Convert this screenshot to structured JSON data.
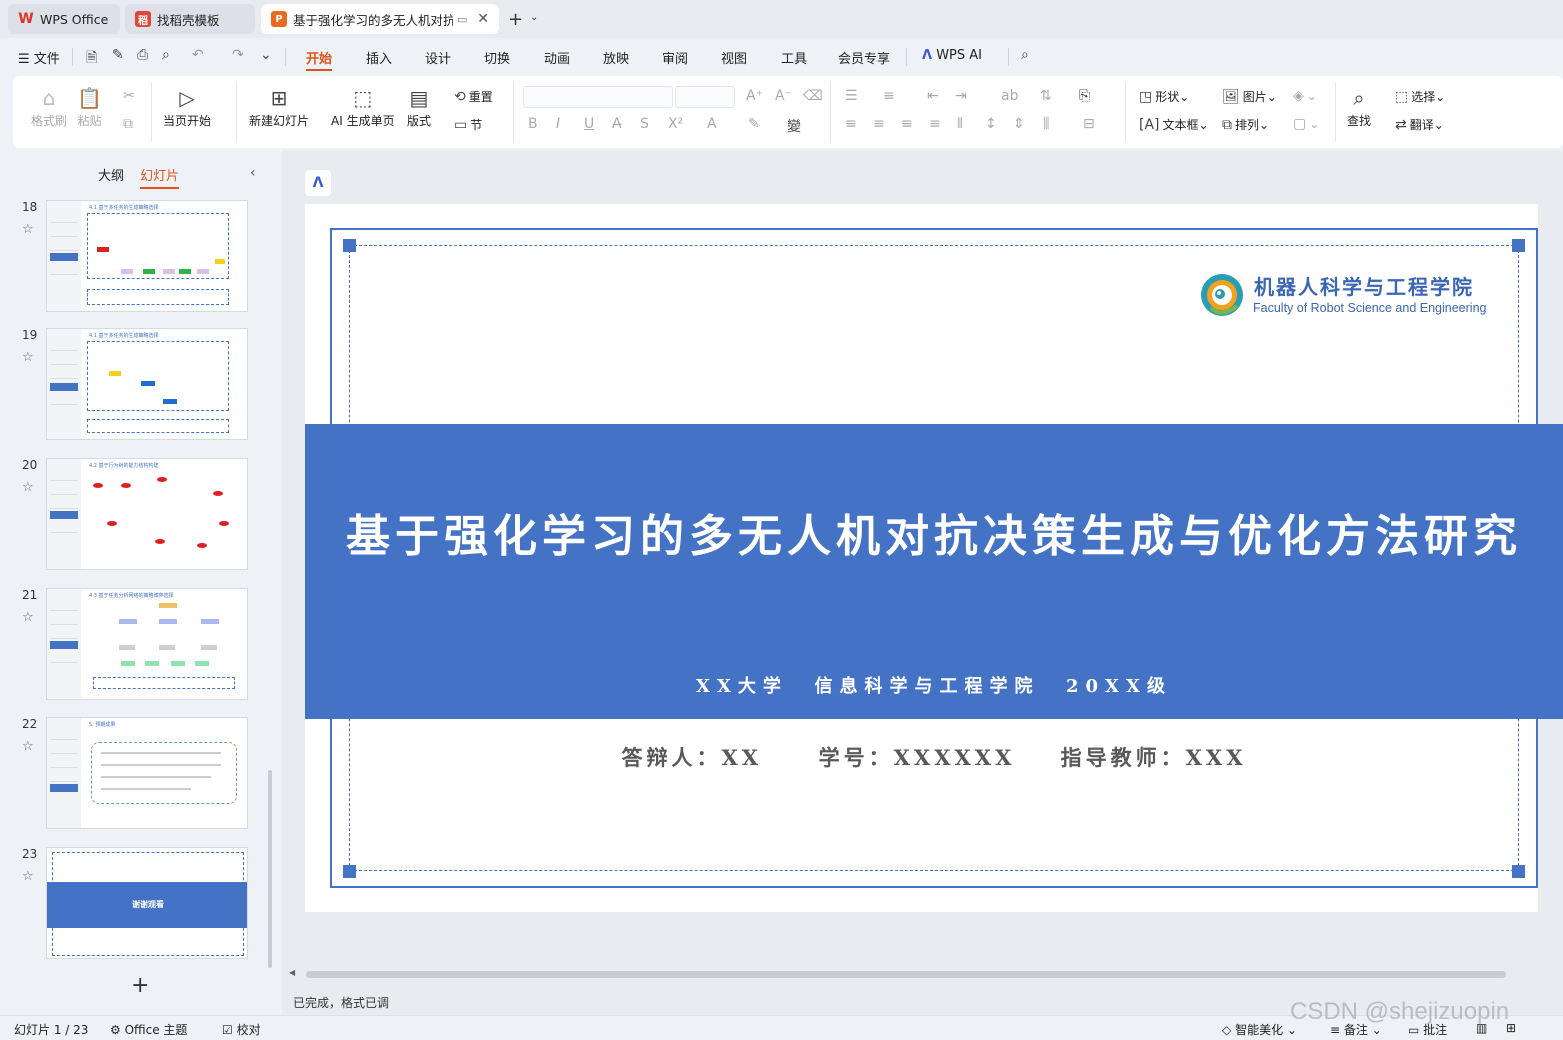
{
  "tabs": [
    {
      "label": "WPS Office"
    },
    {
      "label": "找稻壳模板"
    },
    {
      "label": "基于强化学习的多无人机对抗"
    }
  ],
  "menu": {
    "file": "文件",
    "items": [
      "开始",
      "插入",
      "设计",
      "切换",
      "动画",
      "放映",
      "审阅",
      "视图",
      "工具",
      "会员专享",
      "WPS AI"
    ],
    "active": "开始"
  },
  "ribbon": {
    "format_painter": "格式刷",
    "paste": "粘贴",
    "from_current": "当页开始",
    "new_slide": "新建幻灯片",
    "ai_single": "AI 生成单页",
    "layout": "版式",
    "reset": "重置",
    "section": "节",
    "shape": "形状",
    "picture": "图片",
    "textbox": "文本框",
    "arrange": "排列",
    "find": "查找",
    "select": "选择",
    "translate": "翻译"
  },
  "panel": {
    "outline_tab": "大纲",
    "slides_tab": "幻灯片",
    "slide_numbers": [
      "18",
      "19",
      "20",
      "21",
      "22",
      "23"
    ],
    "thumb_titles": [
      "4.1 基于多任务的生成策略选择",
      "4.1 基于多任务的生成策略选择",
      "4.2 基于行为树的能力结构构建",
      "4.3 基于任务分析网络的策略博弈选择",
      "5. 预期成果",
      ""
    ],
    "thumb23_text": "谢谢观看"
  },
  "slide": {
    "title": "基于强化学习的多无人机对抗决策生成与优化方法研究",
    "subtitle": "XX大学  信息科学与工程学院  20XX级",
    "defense_line": "答辩人：XX     学号：XXXXXX    指导教师：XXX",
    "logo_cn": "机器人科学与工程学院",
    "logo_en": "Faculty of Robot Science and Engineering",
    "accent_color": "#4472C4"
  },
  "status": {
    "message": "已完成，格式已调",
    "slide_counter": "幻灯片 1 / 23",
    "theme": "Office 主题",
    "proof": "校对",
    "smart_beautify": "智能美化",
    "notes": "备注",
    "comments": "批注"
  },
  "watermark": "CSDN @shejizuopin"
}
